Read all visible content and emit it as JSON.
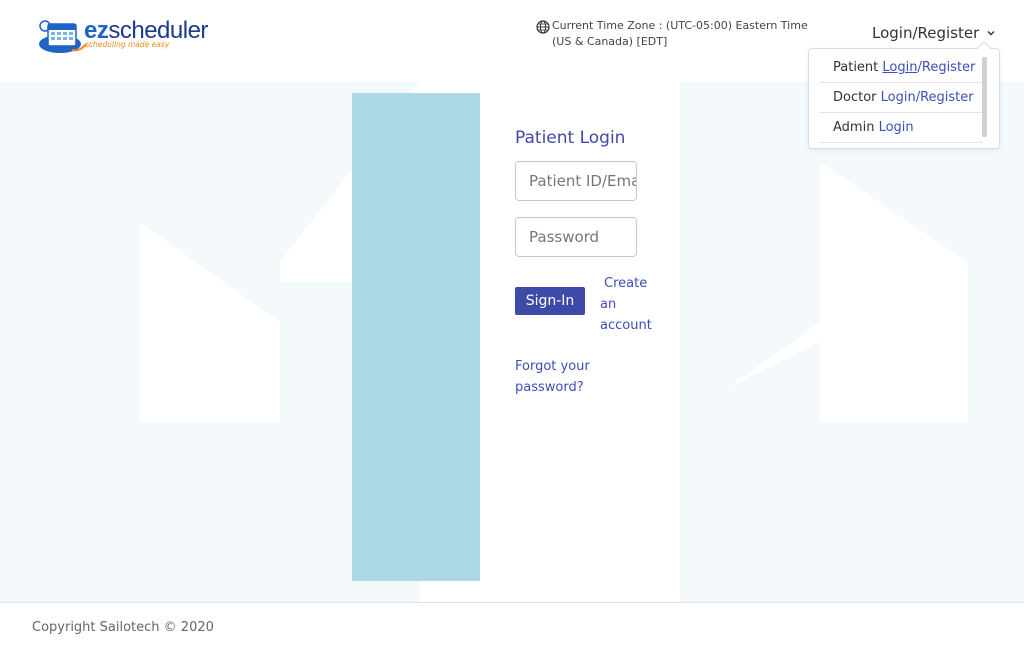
{
  "header": {
    "logo": {
      "brand_ez": "ez",
      "brand_rest": "scheduler",
      "tagline": "scheduling made easy"
    },
    "timezone": {
      "icon": "globe-icon",
      "text": "Current Time Zone : (UTC-05:00) Eastern Time (US & Canada) [EDT]"
    },
    "login_menu": {
      "label": "Login/Register",
      "icon": "chevron-down-icon"
    }
  },
  "dropdown": {
    "patient": {
      "prefix": "Patient ",
      "login": "Login",
      "sep": "/",
      "register": "Register"
    },
    "doctor": {
      "prefix": "Doctor ",
      "link": "Login/Register"
    },
    "admin": {
      "prefix": "Admin ",
      "link": "Login"
    }
  },
  "login_form": {
    "title": "Patient Login",
    "patient_id_placeholder": "Patient ID/Email",
    "password_placeholder": "Password",
    "signin_label": "Sign-In",
    "create_account_words": [
      "Create",
      "an",
      "account"
    ],
    "forgot_password": "Forgot your password?"
  },
  "footer": {
    "copyright": "Copyright Sailotech © 2020"
  },
  "colors": {
    "accent": "#3d4aa8",
    "side_panel": "#add8e6"
  }
}
